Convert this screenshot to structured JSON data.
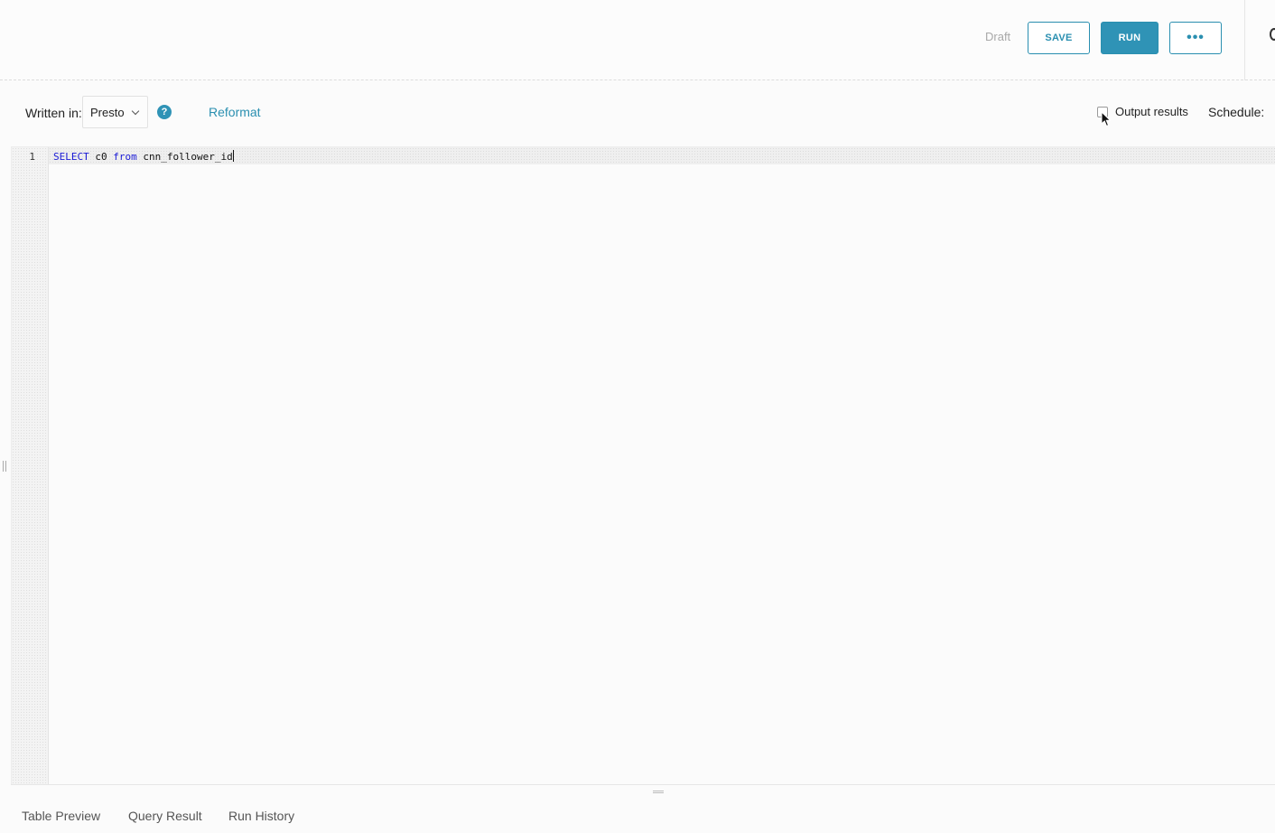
{
  "header": {
    "status": "Draft",
    "save_label": "SAVE",
    "run_label": "RUN",
    "more_label": "•••"
  },
  "toolbar": {
    "written_in_label": "Written in:",
    "language": "Presto",
    "help": "?",
    "reformat_label": "Reformat",
    "output_results_label": "Output results",
    "output_results_checked": false,
    "schedule_label": "Schedule:"
  },
  "editor": {
    "line_numbers": [
      "1"
    ],
    "code": {
      "kw1": "SELECT",
      "col": " c0 ",
      "kw2": "from",
      "table": " cnn_follower_id"
    }
  },
  "tabs": [
    {
      "label": "Table Preview"
    },
    {
      "label": "Query Result"
    },
    {
      "label": "Run History"
    }
  ],
  "colors": {
    "accent": "#2f93b6",
    "keyword": "#1a1ad6"
  }
}
